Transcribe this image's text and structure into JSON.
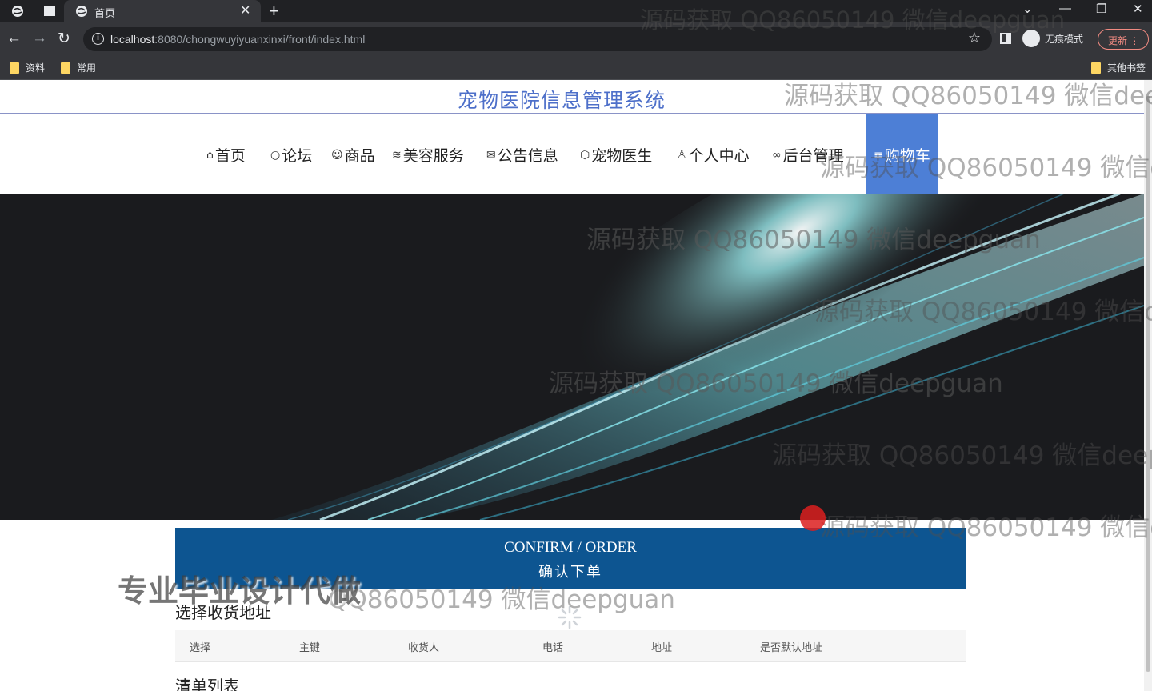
{
  "browser": {
    "tab_title": "首页",
    "url_host": "localhost",
    "url_rest": ":8080/chongwuyiyuanxinxi/front/index.html",
    "incognito_label": "无痕模式",
    "update_label": "更新",
    "bookmarks": [
      "资料",
      "常用"
    ],
    "other_bookmarks": "其他书签"
  },
  "site": {
    "title": "宠物医院信息管理系统",
    "nav": [
      {
        "icon": "home-icon",
        "glyph": "⌂",
        "label": "首页"
      },
      {
        "icon": "forum-icon",
        "glyph": "○",
        "label": "论坛"
      },
      {
        "icon": "goods-icon",
        "glyph": "☺",
        "label": "商品"
      },
      {
        "icon": "layers-icon",
        "glyph": "≋",
        "label": "美容服务"
      },
      {
        "icon": "mail-icon",
        "glyph": "✉",
        "label": "公告信息"
      },
      {
        "icon": "cube-icon",
        "glyph": "⬡",
        "label": "宠物医生"
      },
      {
        "icon": "user-icon",
        "glyph": "♙",
        "label": "个人中心"
      },
      {
        "icon": "link-icon",
        "glyph": "∞",
        "label": "后台管理"
      },
      {
        "icon": "cart-icon",
        "glyph": "≡",
        "label": "购物车"
      }
    ]
  },
  "order": {
    "banner_en": "CONFIRM / ORDER",
    "banner_cn": "确认下单",
    "address_title": "选择收货地址",
    "address_columns": [
      "选择",
      "主键",
      "收货人",
      "电话",
      "地址",
      "是否默认地址"
    ],
    "list_title": "清单列表"
  },
  "watermarks": {
    "text_full": "源码获取 QQ86050149 微信deepguan",
    "text_cut1": "源码获取 QQ86050149 微信deep",
    "text_cut2": "源码获取 QQ86050149 微信de",
    "text_cut3": "源码获取 QQ86050149 微信deepg",
    "text_tail": "QQ86050149 微信deepguan",
    "promo": "专业毕业设计代做"
  },
  "colors": {
    "title_blue": "#4d6fc9",
    "nav_active": "#4d7fd6",
    "confirm_banner": "#0d5591"
  }
}
